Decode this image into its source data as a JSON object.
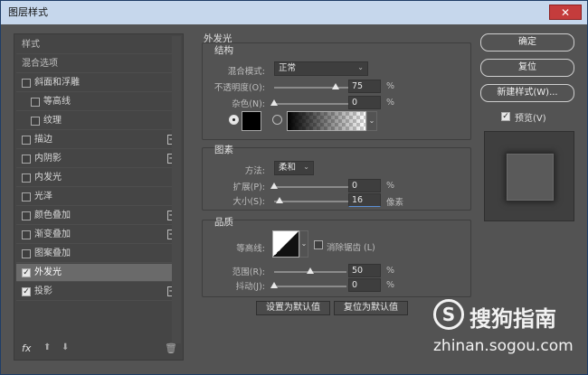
{
  "window": {
    "title": "图层样式",
    "close_glyph": "✕"
  },
  "left_panel": {
    "items": [
      {
        "label": "样式",
        "head": true
      },
      {
        "label": "混合选项",
        "head": true
      },
      {
        "label": "斜面和浮雕",
        "checked": false,
        "plus": false
      },
      {
        "label": "等高线",
        "checked": false,
        "indent": true
      },
      {
        "label": "纹理",
        "checked": false,
        "indent": true
      },
      {
        "label": "描边",
        "checked": false,
        "plus": true
      },
      {
        "label": "内阴影",
        "checked": false,
        "plus": true
      },
      {
        "label": "内发光",
        "checked": false,
        "plus": false
      },
      {
        "label": "光泽",
        "checked": false,
        "plus": false
      },
      {
        "label": "颜色叠加",
        "checked": false,
        "plus": true
      },
      {
        "label": "渐变叠加",
        "checked": false,
        "plus": true
      },
      {
        "label": "图案叠加",
        "checked": false,
        "plus": false
      },
      {
        "label": "外发光",
        "checked": true,
        "plus": false,
        "selected": true
      },
      {
        "label": "投影",
        "checked": true,
        "plus": true
      }
    ],
    "footer": {
      "fx": "fx",
      "up_icon": "arrow-up-icon",
      "down_icon": "arrow-down-icon",
      "trash_icon": "trash-icon"
    }
  },
  "outer_glow": {
    "title": "外发光",
    "structure": {
      "title": "结构",
      "blend_mode_label": "混合模式:",
      "blend_mode_value": "正常",
      "opacity_label": "不透明度(O):",
      "opacity_value": "75",
      "opacity_percent": 0.75,
      "noise_label": "杂色(N):",
      "noise_value": "0",
      "noise_percent": 0,
      "unit": "%",
      "glow_color": "#000000"
    },
    "elements": {
      "title": "图素",
      "method_label": "方法:",
      "method_value": "柔和",
      "spread_label": "扩展(P):",
      "spread_value": "0",
      "spread_percent": 0,
      "size_label": "大小(S):",
      "size_value": "16",
      "size_fraction": 0.065,
      "size_unit": "像素",
      "unit": "%"
    },
    "quality": {
      "title": "品质",
      "contour_label": "等高线:",
      "antialias_label": "消除锯齿 (L)",
      "range_label": "范围(R):",
      "range_value": "50",
      "range_percent": 0.5,
      "jitter_label": "抖动(J):",
      "jitter_value": "0",
      "jitter_percent": 0,
      "unit": "%"
    },
    "set_default": "设置为默认值",
    "reset_default": "复位为默认值"
  },
  "right_panel": {
    "ok": "确定",
    "reset": "复位",
    "new_style": "新建样式(W)...",
    "preview_label": "预览(V)",
    "preview_checked": true
  },
  "watermark": {
    "brand": "搜狗指南",
    "url": "zhinan.sogou.com"
  }
}
